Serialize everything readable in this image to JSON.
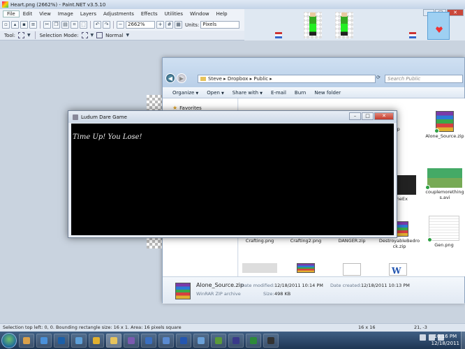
{
  "paintnet": {
    "title": "Heart.png (2662%) - Paint.NET v3.5.10",
    "menu": [
      "File",
      "Edit",
      "View",
      "Image",
      "Layers",
      "Adjustments",
      "Effects",
      "Utilities",
      "Window",
      "Help"
    ],
    "zoom": "2662%",
    "units_label": "Units:",
    "units_value": "Pixels",
    "tool_label": "Tool:",
    "selection_mode_label": "Selection Mode:",
    "blend_mode": "Normal",
    "status_text": "Selection top left: 0, 0. Bounding rectangle size: 16 x 1. Area: 16 pixels square",
    "image_size": "16 x 16",
    "cursor_coords": "21, -3"
  },
  "explorer": {
    "breadcrumb": "Steve  ▸  Dropbox  ▸  Public  ▸",
    "search_placeholder": "Search Public",
    "commands": [
      "Organize",
      "Open",
      "Share with",
      "E-mail",
      "Burn",
      "New folder"
    ],
    "favorites_label": "Favorites",
    "files": [
      {
        "name": "...ne.zip"
      },
      {
        "name": "Alone_Source.zip"
      },
      {
        "name": "...ondLineEx\n...e.png"
      },
      {
        "name": "couplemorething\ns.avi"
      },
      {
        "name": "Crafting.png"
      },
      {
        "name": "Crafting2.png"
      },
      {
        "name": "DANGER.zip"
      },
      {
        "name": "DestroyableBedro\nck.zip"
      },
      {
        "name": "Gen.png"
      }
    ],
    "details": {
      "name": "Alone_Source.zip",
      "type": "WinRAR ZIP archive",
      "modified_label": "Date modified:",
      "modified_value": "12/18/2011 10:14 PM",
      "created_label": "Date created:",
      "created_value": "12/18/2011 10:13 PM",
      "size_label": "Size:",
      "size_value": "498 KB"
    }
  },
  "game": {
    "title": "Ludum Dare Game",
    "message": "Time Up! You Lose!"
  },
  "taskbar": {
    "time": "10:16 PM",
    "date": "12/18/2011"
  },
  "colors": {
    "accent": "#1e3553",
    "game_bg": "#000000"
  }
}
